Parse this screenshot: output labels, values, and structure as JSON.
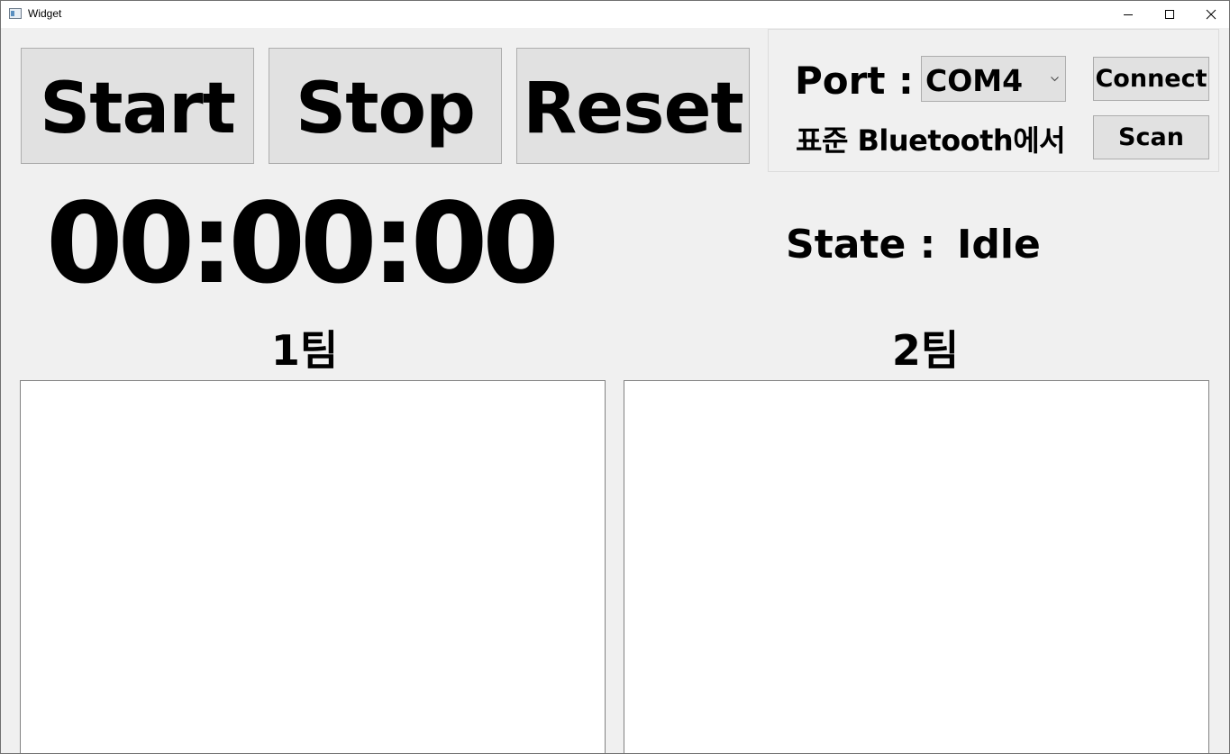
{
  "window": {
    "title": "Widget"
  },
  "controls": {
    "start_label": "Start",
    "stop_label": "Stop",
    "reset_label": "Reset"
  },
  "port_panel": {
    "port_label": "Port :",
    "selected_port": "COM4",
    "connect_label": "Connect",
    "scan_label": "Scan",
    "device_label": "표준 Bluetooth에서"
  },
  "timer": {
    "display": "00:00:00"
  },
  "state": {
    "label": "State :",
    "value": "Idle"
  },
  "teams": [
    {
      "title": "1팀",
      "entries": []
    },
    {
      "title": "2팀",
      "entries": []
    }
  ],
  "icons": {
    "app": "app-window-icon",
    "minimize": "minimize-icon",
    "maximize": "maximize-icon",
    "close": "close-icon",
    "dropdown": "chevron-down-icon"
  }
}
